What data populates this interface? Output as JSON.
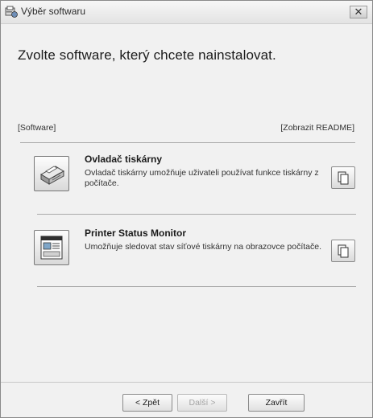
{
  "window": {
    "title": "Výběr softwaru",
    "close_glyph": "✕"
  },
  "heading": "Zvolte software, který chcete nainstalovat.",
  "list_header": {
    "left": "[Software]",
    "right": "[Zobrazit README]"
  },
  "items": [
    {
      "title": "Ovladač tiskárny",
      "description": "Ovladač tiskárny umožňuje uživateli používat funkce tiskárny z počítače.",
      "icon": "printer-icon",
      "readme_icon": "document-icon"
    },
    {
      "title": "Printer Status Monitor",
      "description": "Umožňuje sledovat stav síťové tiskárny na obrazovce počítače.",
      "icon": "status-monitor-icon",
      "readme_icon": "document-icon"
    }
  ],
  "buttons": {
    "back": "< Zpět",
    "next": "Další >",
    "close": "Zavřít"
  }
}
